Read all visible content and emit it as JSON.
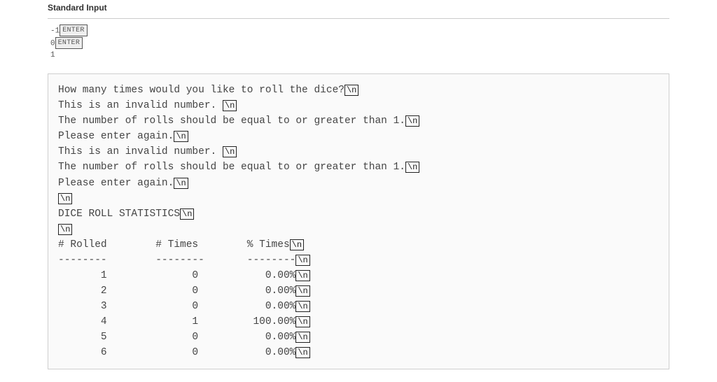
{
  "stdin": {
    "heading": "Standard Input",
    "enter_label": "ENTER",
    "lines": [
      {
        "text": "-1",
        "enter": true
      },
      {
        "text": "0",
        "enter": true
      },
      {
        "text": "1",
        "enter": false
      }
    ]
  },
  "output": {
    "newline_glyph": "\\n",
    "lines": [
      {
        "text": "How many times would you like to roll the dice?",
        "nl": true
      },
      {
        "text": "This is an invalid number. ",
        "nl": true
      },
      {
        "text": "The number of rolls should be equal to or greater than 1.",
        "nl": true
      },
      {
        "text": "Please enter again.",
        "nl": true
      },
      {
        "text": "This is an invalid number. ",
        "nl": true
      },
      {
        "text": "The number of rolls should be equal to or greater than 1.",
        "nl": true
      },
      {
        "text": "Please enter again.",
        "nl": true
      },
      {
        "text": "",
        "nl": true
      },
      {
        "text": "DICE ROLL STATISTICS",
        "nl": true
      },
      {
        "text": "",
        "nl": true
      },
      {
        "text": "# Rolled        # Times        % Times",
        "nl": true
      },
      {
        "text": "--------        --------       --------",
        "nl": true
      },
      {
        "text": "       1              0           0.00%",
        "nl": true
      },
      {
        "text": "       2              0           0.00%",
        "nl": true
      },
      {
        "text": "       3              0           0.00%",
        "nl": true
      },
      {
        "text": "       4              1         100.00%",
        "nl": true
      },
      {
        "text": "       5              0           0.00%",
        "nl": true
      },
      {
        "text": "       6              0           0.00%",
        "nl": true
      }
    ]
  }
}
